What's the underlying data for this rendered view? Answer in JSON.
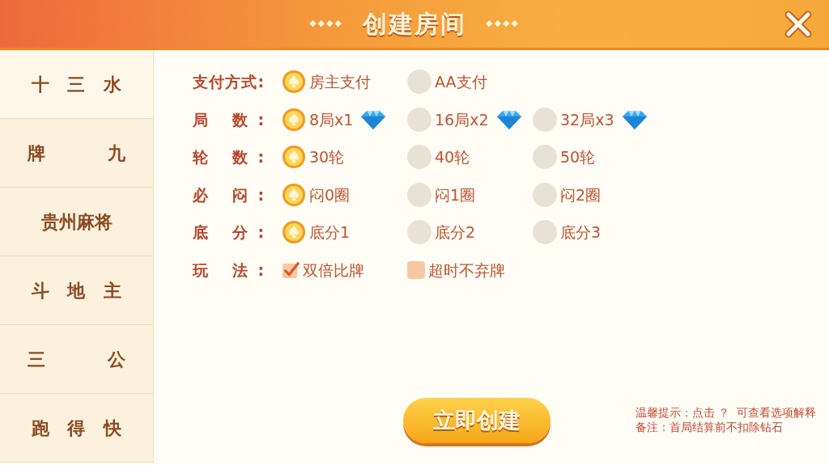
{
  "header": {
    "title": "创建房间",
    "left_ornament": "◆◆◆◆",
    "right_ornament": "◆◆◆◆"
  },
  "sidebar": {
    "items": [
      {
        "label": "十 三 水",
        "selected": true
      },
      {
        "label": "牌 九",
        "selected": false
      },
      {
        "label": "贵州麻将",
        "selected": false
      },
      {
        "label": "斗 地 主",
        "selected": false
      },
      {
        "label": "三 公",
        "selected": false
      },
      {
        "label": "跑 得 快",
        "selected": false
      }
    ]
  },
  "options": [
    {
      "label": "支付方式:",
      "choices": [
        {
          "kind": "radio",
          "text": "房主支付",
          "selected": true,
          "gem": false
        },
        {
          "kind": "radio",
          "text": "AA支付",
          "selected": false,
          "gem": false
        }
      ]
    },
    {
      "label": "局 数:",
      "choices": [
        {
          "kind": "radio",
          "text": "8局x1",
          "selected": true,
          "gem": true
        },
        {
          "kind": "radio",
          "text": "16局x2",
          "selected": false,
          "gem": true
        },
        {
          "kind": "radio",
          "text": "32局x3",
          "selected": false,
          "gem": true
        }
      ]
    },
    {
      "label": "轮 数:",
      "choices": [
        {
          "kind": "radio",
          "text": "30轮",
          "selected": true,
          "gem": false
        },
        {
          "kind": "radio",
          "text": "40轮",
          "selected": false,
          "gem": false
        },
        {
          "kind": "radio",
          "text": "50轮",
          "selected": false,
          "gem": false
        }
      ]
    },
    {
      "label": "必 闷:",
      "choices": [
        {
          "kind": "radio",
          "text": "闷0圈",
          "selected": true,
          "gem": false
        },
        {
          "kind": "radio",
          "text": "闷1圈",
          "selected": false,
          "gem": false
        },
        {
          "kind": "radio",
          "text": "闷2圈",
          "selected": false,
          "gem": false
        }
      ]
    },
    {
      "label": "底 分:",
      "choices": [
        {
          "kind": "radio",
          "text": "底分1",
          "selected": true,
          "gem": false
        },
        {
          "kind": "radio",
          "text": "底分2",
          "selected": false,
          "gem": false
        },
        {
          "kind": "radio",
          "text": "底分3",
          "selected": false,
          "gem": false
        }
      ]
    },
    {
      "label": "玩 法:",
      "choices": [
        {
          "kind": "checkbox",
          "text": "双倍比牌",
          "selected": true,
          "gem": false
        },
        {
          "kind": "checkbox",
          "text": "超时不弃牌",
          "selected": false,
          "gem": false
        }
      ]
    }
  ],
  "create_button": "立即创建",
  "notes": [
    "温馨提示：点击 ？  可查看选项解释",
    "备注：首局结算前不扣除钻石"
  ]
}
